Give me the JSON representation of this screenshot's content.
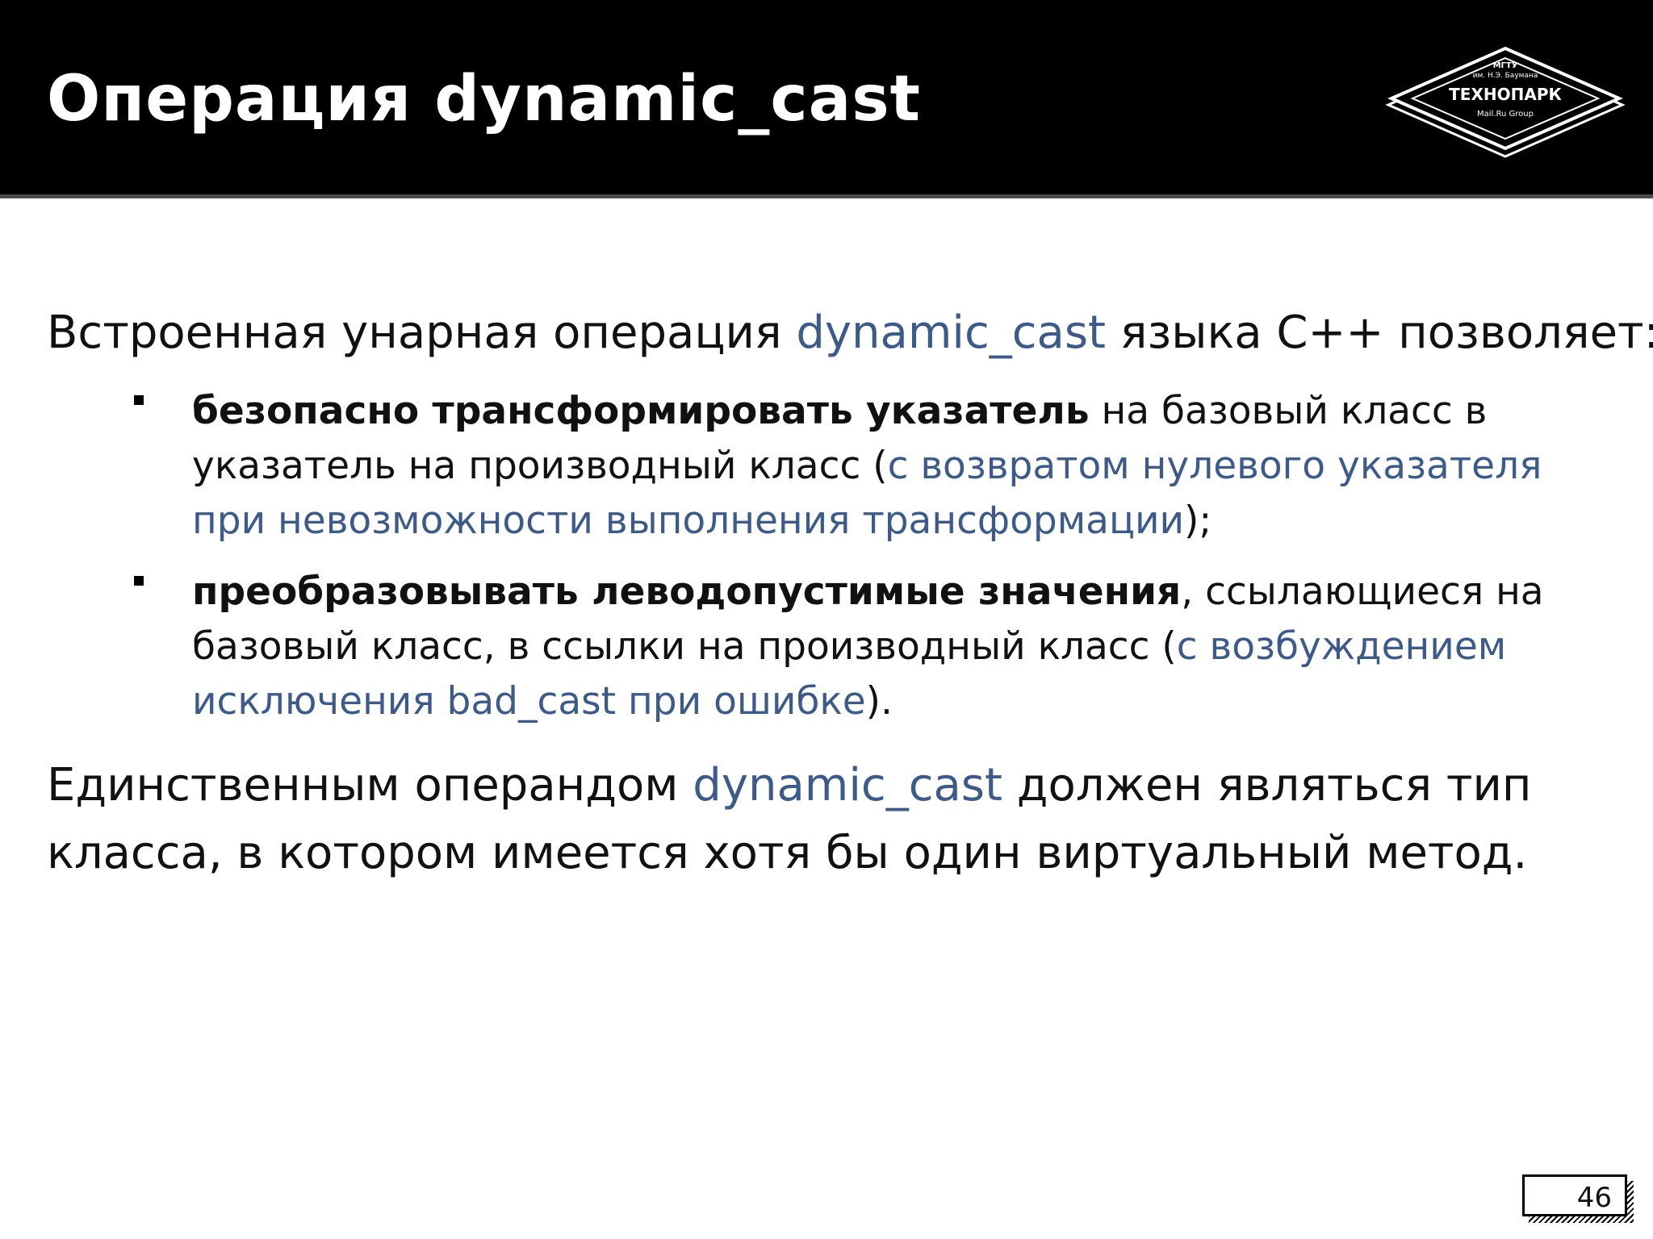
{
  "header": {
    "title": "Операция dynamic_cast",
    "logo": {
      "line1": "МГТУ",
      "line2": "им. Н.Э. Баумана",
      "brand": "ТЕХНОПАРК",
      "line3": "Mail.Ru Group"
    }
  },
  "intro": {
    "part1": "Встроенная унарная операция ",
    "keyword": "dynamic_cast",
    "part2": " языка C++ позволяет:"
  },
  "bullets": [
    {
      "bold": "безопасно трансформировать указатель",
      "text": " на базовый класс в указатель на производный класс (",
      "accent": "с возвратом нулевого указателя при невозможности выполнения трансформации",
      "tail": ");"
    },
    {
      "bold": "преобразовывать леводопустимые значения",
      "text": ", ссылающиеся на базовый класс, в ссылки на производный класс (",
      "accent": "с возбуждением исключения bad_cast при ошибке",
      "tail": ")."
    }
  ],
  "outro": {
    "part1": "Единственным операндом ",
    "keyword": "dynamic_cast",
    "part2": " должен являться тип класса, в котором имеется хотя бы один виртуальный метод."
  },
  "page_number": "46",
  "colors": {
    "accent": "#3c5a8a",
    "header_bg": "#000000"
  }
}
